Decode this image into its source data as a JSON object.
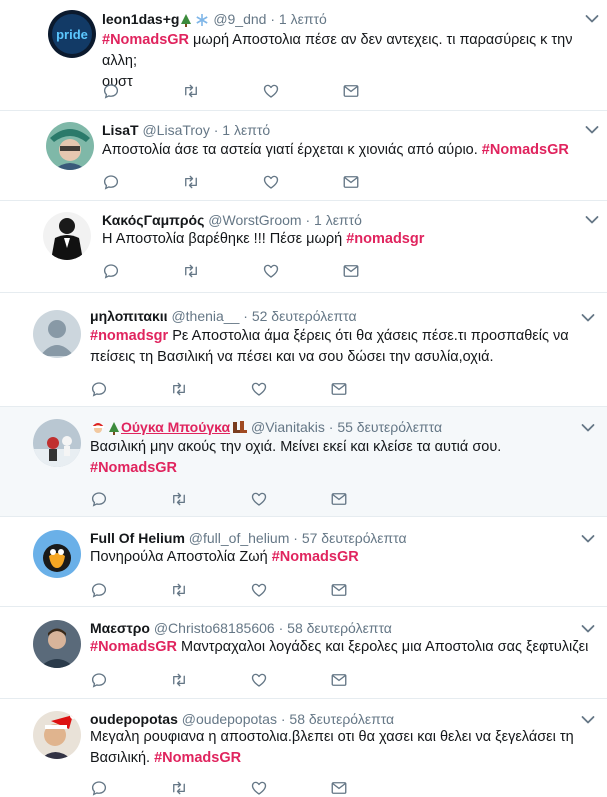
{
  "colors": {
    "hashtag": "#e0245e",
    "muted": "#657786",
    "divider": "#e6ecf0",
    "highlight_bg": "#f5f8fa"
  },
  "icons": [
    "reply-icon",
    "retweet-icon",
    "like-icon",
    "dm-icon",
    "chevron-down-icon"
  ],
  "tweets": [
    {
      "name": "leon1das+g",
      "handle": "@9_dnd",
      "sep": "·",
      "time": "1 λεπτό",
      "line1_tag": "#NomadsGR",
      "line1_rest": " μωρή Αποστολια πέσε αν δεν αντεχεις. τι παρασύρεις κ την αλλη;",
      "line2": "ουστ"
    },
    {
      "name": "LisaT",
      "handle": "@LisaTroy",
      "sep": "·",
      "time": "1 λεπτό",
      "line1_text": "Αποστολία άσε τα αστεία γιατί έρχεται κ χιονιάς από αύριο. ",
      "line1_tag": "#NomadsGR"
    },
    {
      "name": "ΚακόςΓαμπρός",
      "handle": "@WorstGroom",
      "sep": "·",
      "time": "1 λεπτό",
      "line1_text": "Η Αποστολία βαρέθηκε !!! Πέσε μωρή ",
      "line1_tag": "#nomadsgr"
    },
    {
      "name": "μηλοπιτακιι",
      "handle": "@thenia__",
      "sep": "·",
      "time": "52 δευτερόλεπτα",
      "line1_tag": "#nomadsgr",
      "line1_rest": "  Ρε Αποστολια άμα ξέρεις ότι θα χάσεις πέσε.τι προσπαθείς να",
      "line2": "πείσεις τη Βασιλική να πέσει και να σου δώσει την ασυλία,οχιά."
    },
    {
      "name": "Ούγκα Μπούγκα",
      "handle": "@Vianitakis",
      "sep": "·",
      "time": "55 δευτερόλεπτα",
      "line1_text": "Βασιλική μην ακούς την οχιά. Μείνει εκεί και κλείσε τα αυτιά σου.",
      "line2_tag": "#NomadsGR"
    },
    {
      "name": "Full Of Helium",
      "handle": "@full_of_helium",
      "sep": "·",
      "time": "57 δευτερόλεπτα",
      "line1_text": "Πονηρούλα Αποστολία Ζωή ",
      "line1_tag": "#NomadsGR"
    },
    {
      "name": "Μαεστρο",
      "handle": "@Christo68185606",
      "sep": "·",
      "time": "58 δευτερόλεπτα",
      "line1_tag": "#NomadsGR",
      "line1_rest": " Μαντραχαλοι λογάδες και ξερολες μια Αποστολια σας ξεφτυλιζει"
    },
    {
      "name": "oudepopotas",
      "handle": "@oudepopotas",
      "sep": "·",
      "time": "58 δευτερόλεπτα",
      "line1_text": "Μεγαλη ρουφιανα η αποστολια.βλεπει οτι θα χασει και θελει να ξεγελάσει τη",
      "line2_text": "Βασιλική. ",
      "line2_tag": "#NomadsGR"
    }
  ]
}
